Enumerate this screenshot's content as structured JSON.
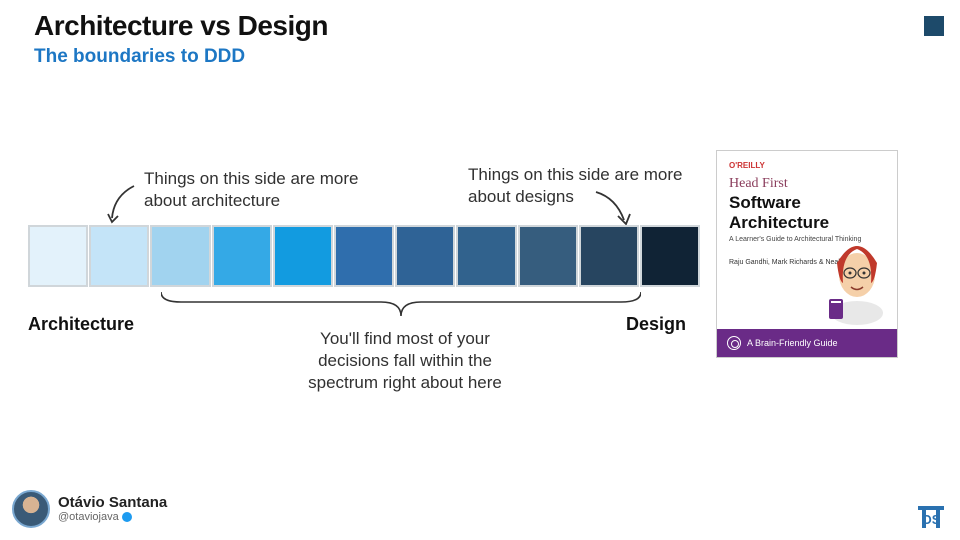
{
  "header": {
    "title": "Architecture vs Design",
    "subtitle": "The boundaries to DDD"
  },
  "spectrum": {
    "left_label": "Architecture",
    "right_label": "Design",
    "note_left": "Things on this side are more about architecture",
    "note_right": "Things on this side are more about designs",
    "note_bottom": "You'll find most of your decisions fall within the spectrum right about here",
    "swatches": [
      "#e3f2fb",
      "#c4e4f8",
      "#a1d3ef",
      "#34a9e6",
      "#129be0",
      "#2f6ead",
      "#2f6396",
      "#31628d",
      "#365d7e",
      "#274560",
      "#102335"
    ]
  },
  "book": {
    "publisher": "O'REILLY",
    "series": "Head First",
    "title_line1": "Software",
    "title_line2": "Architecture",
    "subtitle": "A Learner's Guide to Architectural Thinking",
    "authors": "Raju Gandhi,\nMark Richards\n& Neal Ford",
    "band": "A Brain-Friendly Guide"
  },
  "presenter": {
    "name": "Otávio Santana",
    "handle": "@otaviojava"
  },
  "logo_text": "OS"
}
